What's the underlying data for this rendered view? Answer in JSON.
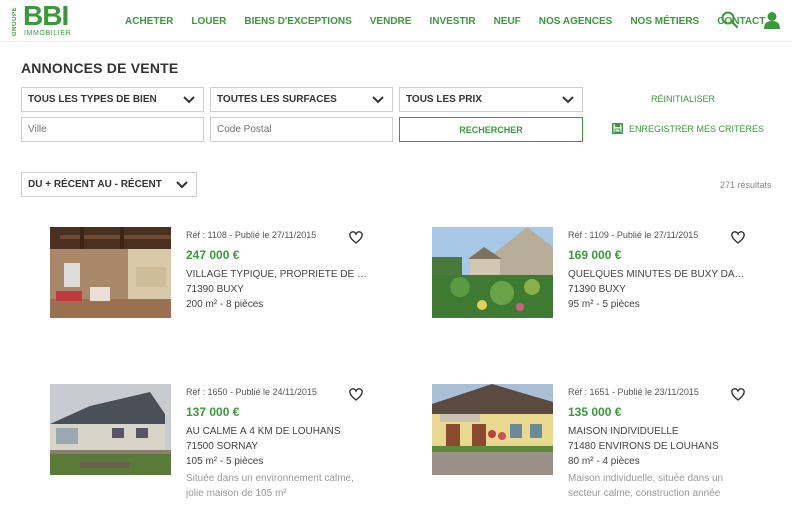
{
  "brand": {
    "groupe": "GROUPE",
    "name": "BBI",
    "sub": "IMMOBILIER"
  },
  "nav": [
    "ACHETER",
    "LOUER",
    "BIENS D'EXCEPTIONS",
    "VENDRE",
    "INVESTIR",
    "NEUF",
    "NOS AGENCES",
    "NOS MÉTIERS",
    "CONTACT"
  ],
  "page_title": "ANNONCES DE VENTE",
  "filters": {
    "type": "TOUS LES TYPES DE BIEN",
    "surface": "TOUTES LES SURFACES",
    "price": "TOUS LES PRIX",
    "city_placeholder": "Ville",
    "postal_placeholder": "Code Postal",
    "search_label": "RECHERCHER",
    "reset_label": "RÉINITIALISER",
    "save_label": "ENREGISTRER MES CRITÈRES"
  },
  "sort": {
    "label": "DU + RÉCENT AU - RÉCENT"
  },
  "results": {
    "count": "271 résultats"
  },
  "listings": [
    {
      "ref": "Réf : 1108 - Publié le 27/11/2015",
      "price": "247 000 €",
      "title": "VILLAGE TYPIQUE, PROPRIETE DE C...",
      "location": "71390 BUXY",
      "size": "200 m² - 8 pièces",
      "desc": ""
    },
    {
      "ref": "Réf : 1109 - Publié le 27/11/2015",
      "price": "169 000 €",
      "title": "QUELQUES MINUTES DE BUXY DANS ...",
      "location": "71390 BUXY",
      "size": "95 m² - 5 pièces",
      "desc": ""
    },
    {
      "ref": "Réf : 1650 - Publié le 24/11/2015",
      "price": "137 000 €",
      "title": "AU CALME À 4 KM DE LOUHANS",
      "location": "71500 SORNAY",
      "size": "105 m² - 5 pièces",
      "desc": "Située dans un environnement calme, jolie maison de 105 m²"
    },
    {
      "ref": "Réf : 1651 - Publié le 23/11/2015",
      "price": "135 000 €",
      "title": "MAISON INDIVIDUELLE",
      "location": "71480 ENVIRONS DE LOUHANS",
      "size": "80 m² - 4 pièces",
      "desc": "Maison individuelle, située dans un secteur calme, construction année"
    }
  ],
  "colors": {
    "accent": "#3a9a3a",
    "text": "#444444",
    "muted": "#999999"
  },
  "icons": {
    "search": "search-icon",
    "user": "user-icon",
    "favorite": "heart-icon",
    "save": "floppy-disk-icon",
    "dropdown": "chevron-down-icon"
  }
}
